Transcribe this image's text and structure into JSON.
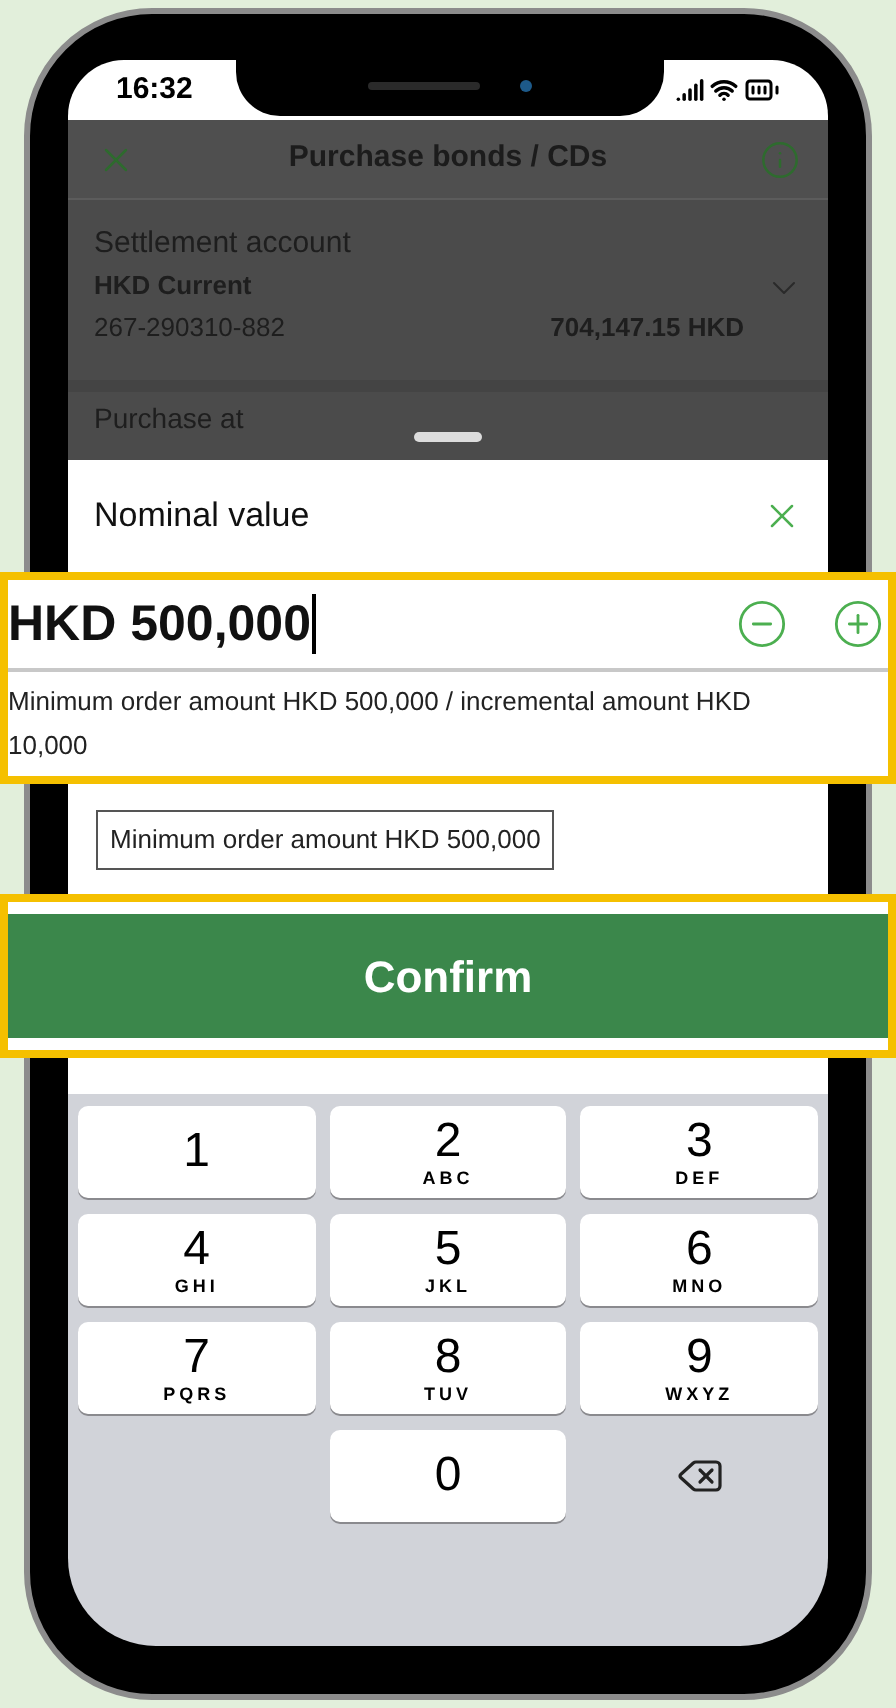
{
  "status_bar": {
    "time": "16:32"
  },
  "header": {
    "title": "Purchase bonds / CDs"
  },
  "settlement": {
    "label": "Settlement account",
    "account_name": "HKD Current",
    "account_number": "267-290310-882",
    "balance": "704,147.15 HKD"
  },
  "next_field": {
    "label": "Purchase at"
  },
  "sheet": {
    "title": "Nominal value",
    "amount": {
      "value": "HKD 500,000"
    },
    "hint": "Minimum order amount HKD 500,000 / incremental amount HKD 10,000",
    "error_message": "Minimum order amount HKD 500,000",
    "confirm_button": "Confirm"
  },
  "keypad": {
    "keys": [
      {
        "kind": "digit",
        "digit": "1"
      },
      {
        "kind": "digit",
        "digit": "2",
        "letters": "ABC"
      },
      {
        "kind": "digit",
        "digit": "3",
        "letters": "DEF"
      },
      {
        "kind": "digit",
        "digit": "4",
        "letters": "GHI"
      },
      {
        "kind": "digit",
        "digit": "5",
        "letters": "JKL"
      },
      {
        "kind": "digit",
        "digit": "6",
        "letters": "MNO"
      },
      {
        "kind": "digit",
        "digit": "7",
        "letters": "PQRS"
      },
      {
        "kind": "digit",
        "digit": "8",
        "letters": "TUV"
      },
      {
        "kind": "digit",
        "digit": "9",
        "letters": "WXYZ"
      },
      {
        "kind": "blank"
      },
      {
        "kind": "digit",
        "digit": "0"
      },
      {
        "kind": "delete"
      }
    ]
  }
}
